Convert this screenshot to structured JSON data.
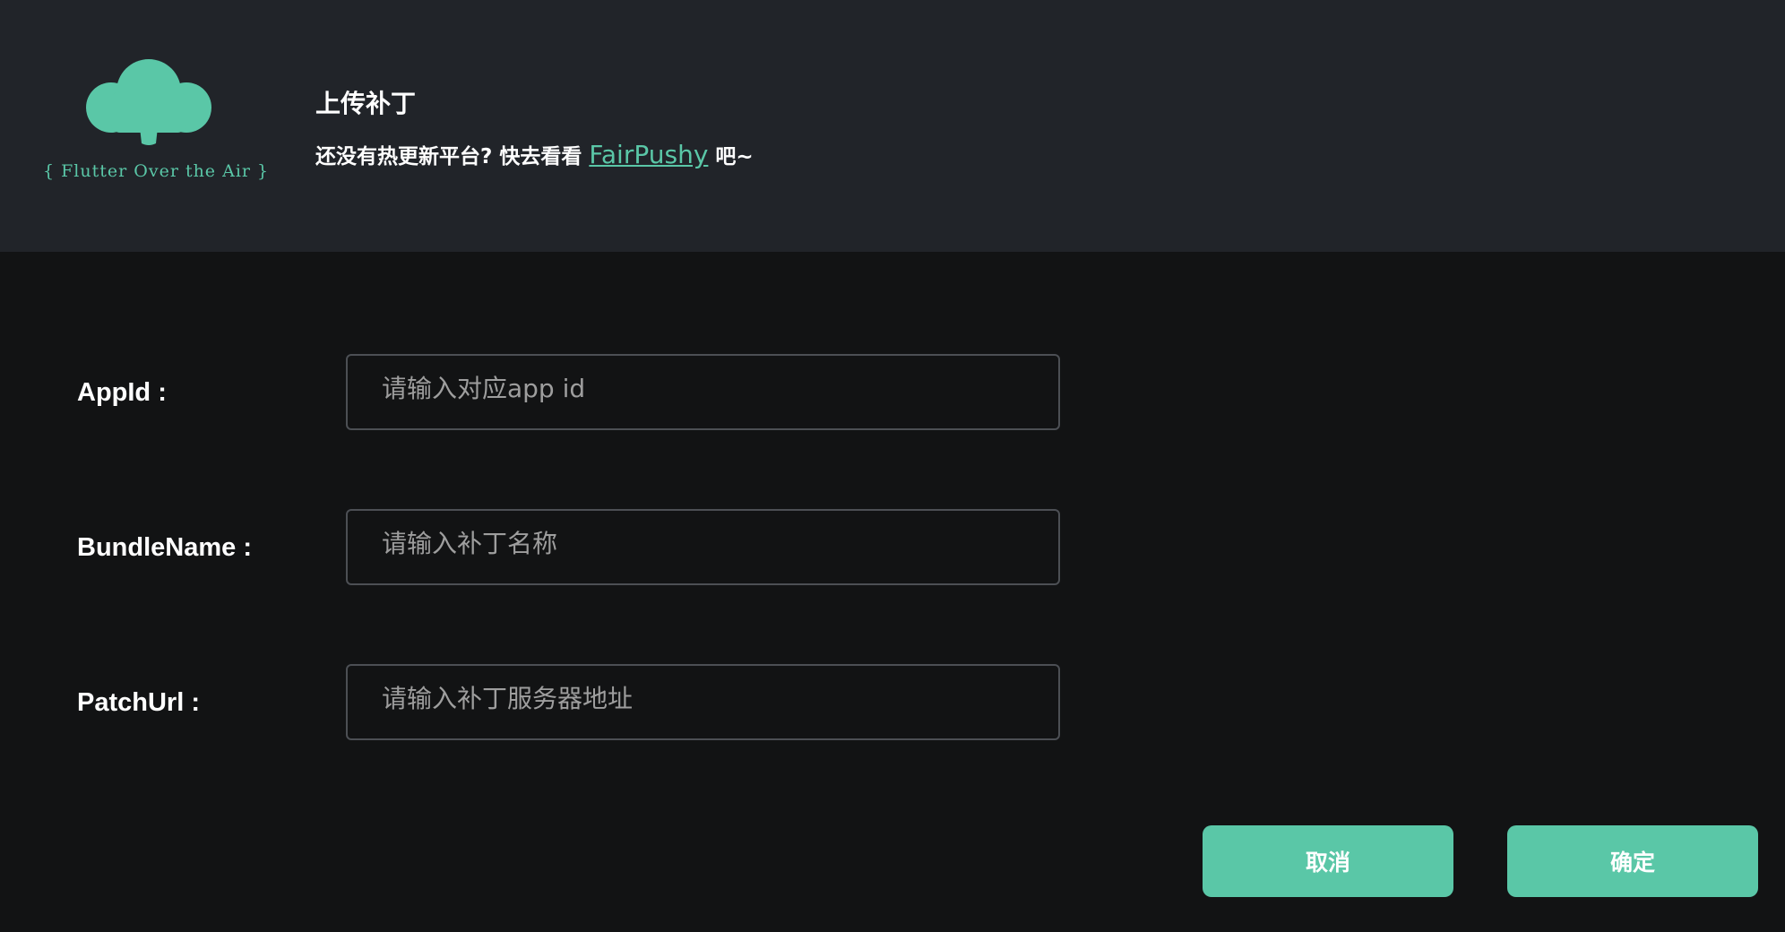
{
  "header": {
    "logo_text": "{ Flutter Over the Air }",
    "title": "上传补丁",
    "subtitle_prefix": "还没有热更新平台? 快去看看 ",
    "subtitle_link": "FairPushy",
    "subtitle_suffix": " 吧~"
  },
  "form": {
    "appid": {
      "label": "AppId :",
      "placeholder": "请输入对应app id",
      "value": ""
    },
    "bundle_name": {
      "label": "BundleName :",
      "placeholder": "请输入补丁名称",
      "value": ""
    },
    "patch_url": {
      "label": "PatchUrl :",
      "placeholder": "请输入补丁服务器地址",
      "value": ""
    }
  },
  "buttons": {
    "cancel": "取消",
    "confirm": "确定"
  },
  "colors": {
    "accent": "#5ac7a7",
    "header_bg": "#212429",
    "page_bg": "#121314"
  },
  "icons": {
    "logo": "cloud-tree-logo-icon"
  }
}
